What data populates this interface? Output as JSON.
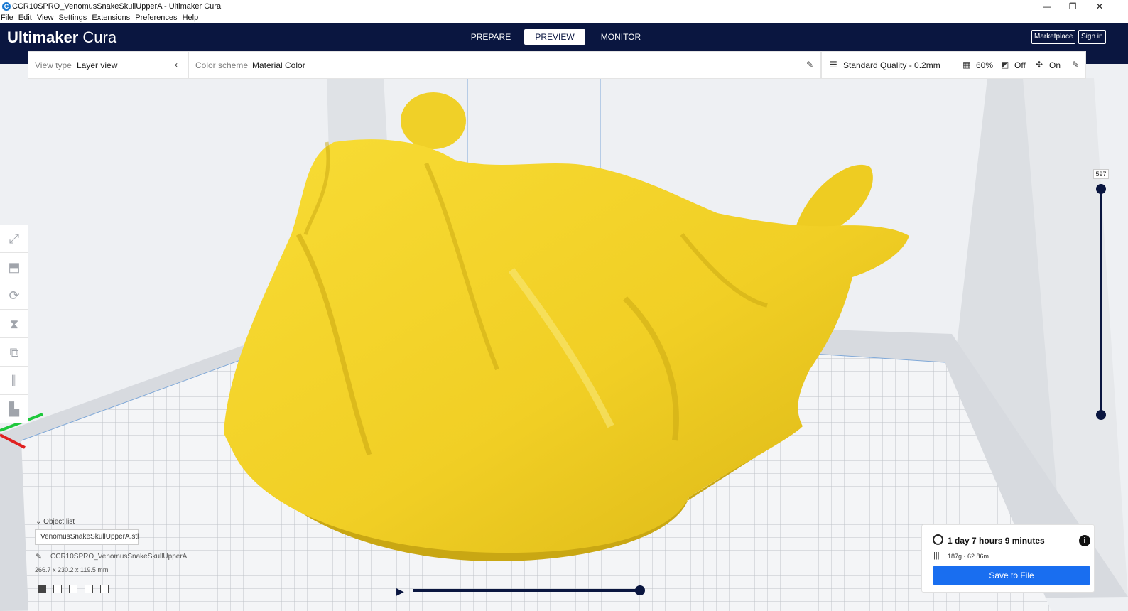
{
  "window": {
    "title": "CCR10SPRO_VenomusSnakeSkullUpperA - Ultimaker Cura",
    "app_icon_letter": "C",
    "controls": {
      "minimize": "—",
      "maximize": "❐",
      "close": "✕"
    }
  },
  "menu": [
    "File",
    "Edit",
    "View",
    "Settings",
    "Extensions",
    "Preferences",
    "Help"
  ],
  "header": {
    "logo_bold": "Ultimaker",
    "logo_light": " Cura",
    "stages": [
      "PREPARE",
      "PREVIEW",
      "MONITOR"
    ],
    "active_stage": "PREVIEW",
    "marketplace": "Marketplace",
    "sign_in": "Sign in"
  },
  "view_panel": {
    "view_type_label": "View type",
    "view_type_value": "Layer view",
    "color_scheme_label": "Color scheme",
    "color_scheme_value": "Material Color"
  },
  "print_settings": {
    "quality": "Standard Quality - 0.2mm",
    "infill": "60%",
    "support": "Off",
    "adhesion": "On"
  },
  "layer_slider": {
    "current_layer": "597"
  },
  "object_list": {
    "header": "Object list",
    "items": [
      "VenomusSnakeSkullUpperA.stl"
    ],
    "job_name": "CCR10SPRO_VenomusSnakeSkullUpperA",
    "dimensions": "266.7 x 230.2 x 119.5 mm"
  },
  "print_info": {
    "time": "1 day 7 hours 9 minutes",
    "material": "187g · 62.86m",
    "save_button": "Save to File"
  },
  "colors": {
    "header_bg": "#0a1640",
    "model": "#f3d22a",
    "accent_blue": "#196ef0"
  },
  "playback": {
    "progress": 1.0
  }
}
